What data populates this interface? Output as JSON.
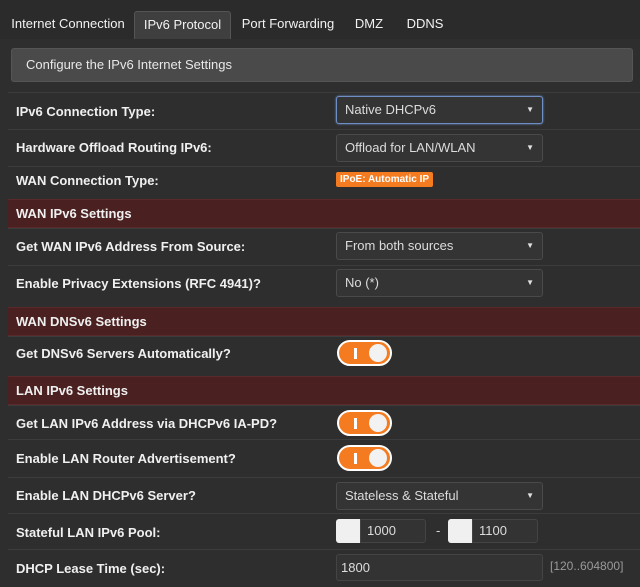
{
  "tabs": [
    {
      "label": "Internet Connection",
      "active": false
    },
    {
      "label": "IPv6 Protocol",
      "active": true
    },
    {
      "label": "Port Forwarding",
      "active": false
    },
    {
      "label": "DMZ",
      "active": false
    },
    {
      "label": "DDNS",
      "active": false
    }
  ],
  "config_bar": {
    "title": "Configure the IPv6 Internet Settings"
  },
  "rows": {
    "connection_type": {
      "label": "IPv6 Connection Type:",
      "value": "Native DHCPv6"
    },
    "hw_offload": {
      "label": "Hardware Offload Routing IPv6:",
      "value": "Offload for LAN/WLAN"
    },
    "wan_conn_type": {
      "label": "WAN Connection Type:",
      "badge": "IPoE: Automatic IP"
    },
    "wan_ipv6_source": {
      "label": "Get WAN IPv6 Address From Source:",
      "value": "From both sources"
    },
    "privacy_ext": {
      "label": "Enable Privacy Extensions (RFC 4941)?",
      "value": "No (*)"
    },
    "dnsv6_auto": {
      "label": "Get DNSv6 Servers Automatically?",
      "toggle_on": true
    },
    "lan_ia_pd": {
      "label": "Get LAN IPv6 Address via DHCPv6 IA-PD?",
      "toggle_on": true
    },
    "lan_router_adv": {
      "label": "Enable LAN Router Advertisement?",
      "toggle_on": true
    },
    "lan_dhcpv6": {
      "label": "Enable LAN DHCPv6 Server?",
      "value": "Stateless & Stateful"
    },
    "stateful_pool": {
      "label": "Stateful LAN IPv6 Pool:",
      "start": "1000",
      "separator": "-",
      "end": "1100"
    },
    "lease_time": {
      "label": "DHCP Lease Time (sec):",
      "value": "1800",
      "hint": "[120..604800]"
    }
  },
  "sections": {
    "wan_ipv6": "WAN IPv6 Settings",
    "wan_dnsv6": "WAN DNSv6 Settings",
    "lan_ipv6": "LAN IPv6 Settings"
  },
  "colors": {
    "accent": "#f47b20",
    "section_bg": "#4a2020",
    "background": "#2a2a2a"
  }
}
